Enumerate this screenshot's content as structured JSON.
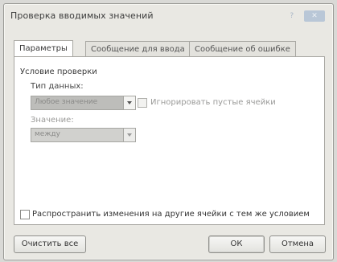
{
  "window": {
    "title": "Проверка вводимых значений"
  },
  "tabs": [
    {
      "label": "Параметры",
      "active": true
    },
    {
      "label": "Сообщение для ввода",
      "active": false
    },
    {
      "label": "Сообщение об ошибке",
      "active": false
    }
  ],
  "panel": {
    "section_label": "Условие проверки",
    "data_type": {
      "label": "Тип данных:",
      "value": "Любое значение"
    },
    "ignore_blank": {
      "label": "Игнорировать пустые ячейки",
      "checked": false,
      "enabled": false
    },
    "value_field": {
      "label": "Значение:",
      "value": "между",
      "enabled": false
    },
    "apply_all": {
      "label": "Распространить изменения на другие ячейки с тем же условием",
      "checked": false
    }
  },
  "buttons": {
    "clear_all": "Очистить все",
    "ok": "ОК",
    "cancel": "Отмена"
  },
  "colors": {
    "dialog_bg": "#e9e8e3",
    "panel_bg": "#ffffff",
    "close_button": "#b9c7d7"
  }
}
